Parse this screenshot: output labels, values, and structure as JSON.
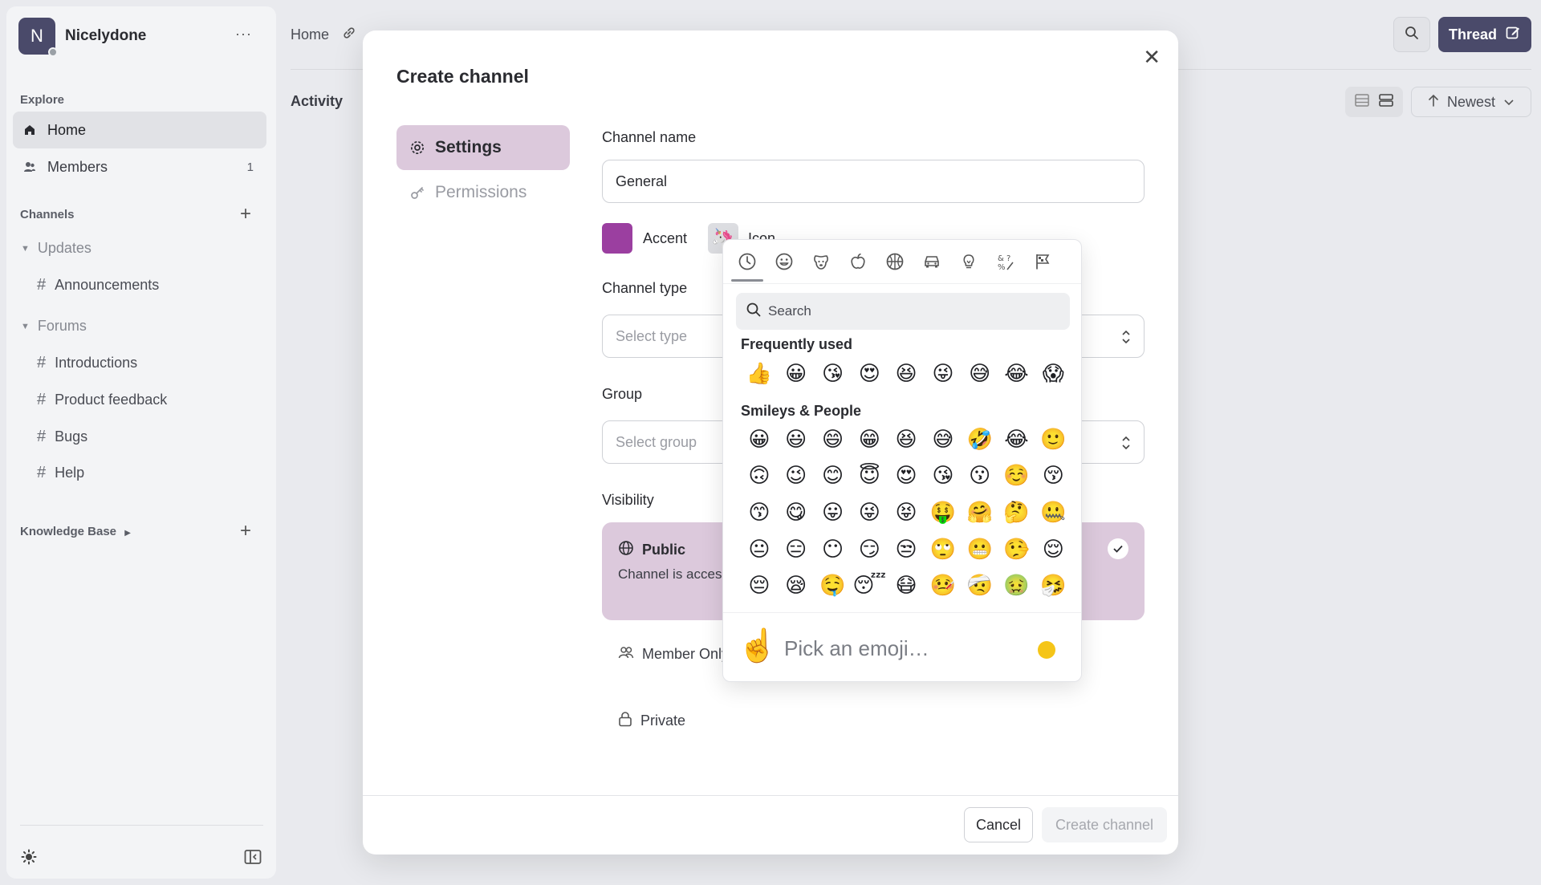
{
  "workspace": {
    "initial": "N",
    "name": "Nicelydone",
    "more": "···"
  },
  "sidebar": {
    "explore_label": "Explore",
    "items": [
      {
        "label": "Home",
        "icon": "home-icon"
      },
      {
        "label": "Members",
        "icon": "members-icon",
        "count": "1"
      }
    ],
    "channels_label": "Channels",
    "groups": [
      {
        "label": "Updates",
        "channels": [
          "Announcements"
        ]
      },
      {
        "label": "Forums",
        "channels": [
          "Introductions",
          "Product feedback",
          "Bugs",
          "Help"
        ]
      }
    ],
    "knowledge_base_label": "Knowledge Base"
  },
  "topbar": {
    "breadcrumb": "Home",
    "thread_label": "Thread",
    "activity_label": "Activity",
    "sort_label": "Newest"
  },
  "modal": {
    "title": "Create channel",
    "tabs": [
      {
        "label": "Settings",
        "icon": "gear-icon"
      },
      {
        "label": "Permissions",
        "icon": "key-icon"
      }
    ],
    "channel_name_label": "Channel name",
    "channel_name_value": "General",
    "accent_label": "Accent",
    "accent_color": "#9b3fa0",
    "icon_label": "Icon",
    "icon_value": "🦄",
    "channel_type_label": "Channel type",
    "channel_type_placeholder": "Select type",
    "group_label": "Group",
    "group_placeholder": "Select group",
    "visibility_label": "Visibility",
    "visibility_options": [
      {
        "title": "Public",
        "description": "Channel is accessible to all community members",
        "selected": true
      },
      {
        "title": "Member Only",
        "selected": false
      },
      {
        "title": "Private",
        "selected": false
      }
    ],
    "cancel_label": "Cancel",
    "create_label": "Create channel"
  },
  "emoji_picker": {
    "categories": [
      "recent-icon",
      "smiley-icon",
      "animal-icon",
      "food-icon",
      "activity-icon",
      "travel-icon",
      "objects-icon",
      "symbols-icon",
      "flags-icon"
    ],
    "search_placeholder": "Search",
    "frequently_used_label": "Frequently used",
    "frequently_used": [
      "👍",
      "😀",
      "😘",
      "😍",
      "😆",
      "😜",
      "😅",
      "😂",
      "😱"
    ],
    "smileys_label": "Smileys & People",
    "smileys": [
      [
        "😀",
        "😃",
        "😄",
        "😁",
        "😆",
        "😅",
        "🤣",
        "😂",
        "🙂"
      ],
      [
        "🙃",
        "😉",
        "😊",
        "😇",
        "😍",
        "😘",
        "😗",
        "☺️",
        "😚"
      ],
      [
        "😙",
        "😋",
        "😛",
        "😜",
        "😝",
        "🤑",
        "🤗",
        "🤔",
        "🤐"
      ],
      [
        "😐",
        "😑",
        "😶",
        "😏",
        "😒",
        "🙄",
        "😬",
        "🤥",
        "😌"
      ],
      [
        "😔",
        "😪",
        "🤤",
        "😴",
        "😷",
        "🤒",
        "🤕",
        "🤢",
        "🤧"
      ]
    ],
    "preview_emoji": "☝️",
    "preview_text": "Pick an emoji…",
    "skin_tone_color": "#f5c518"
  }
}
